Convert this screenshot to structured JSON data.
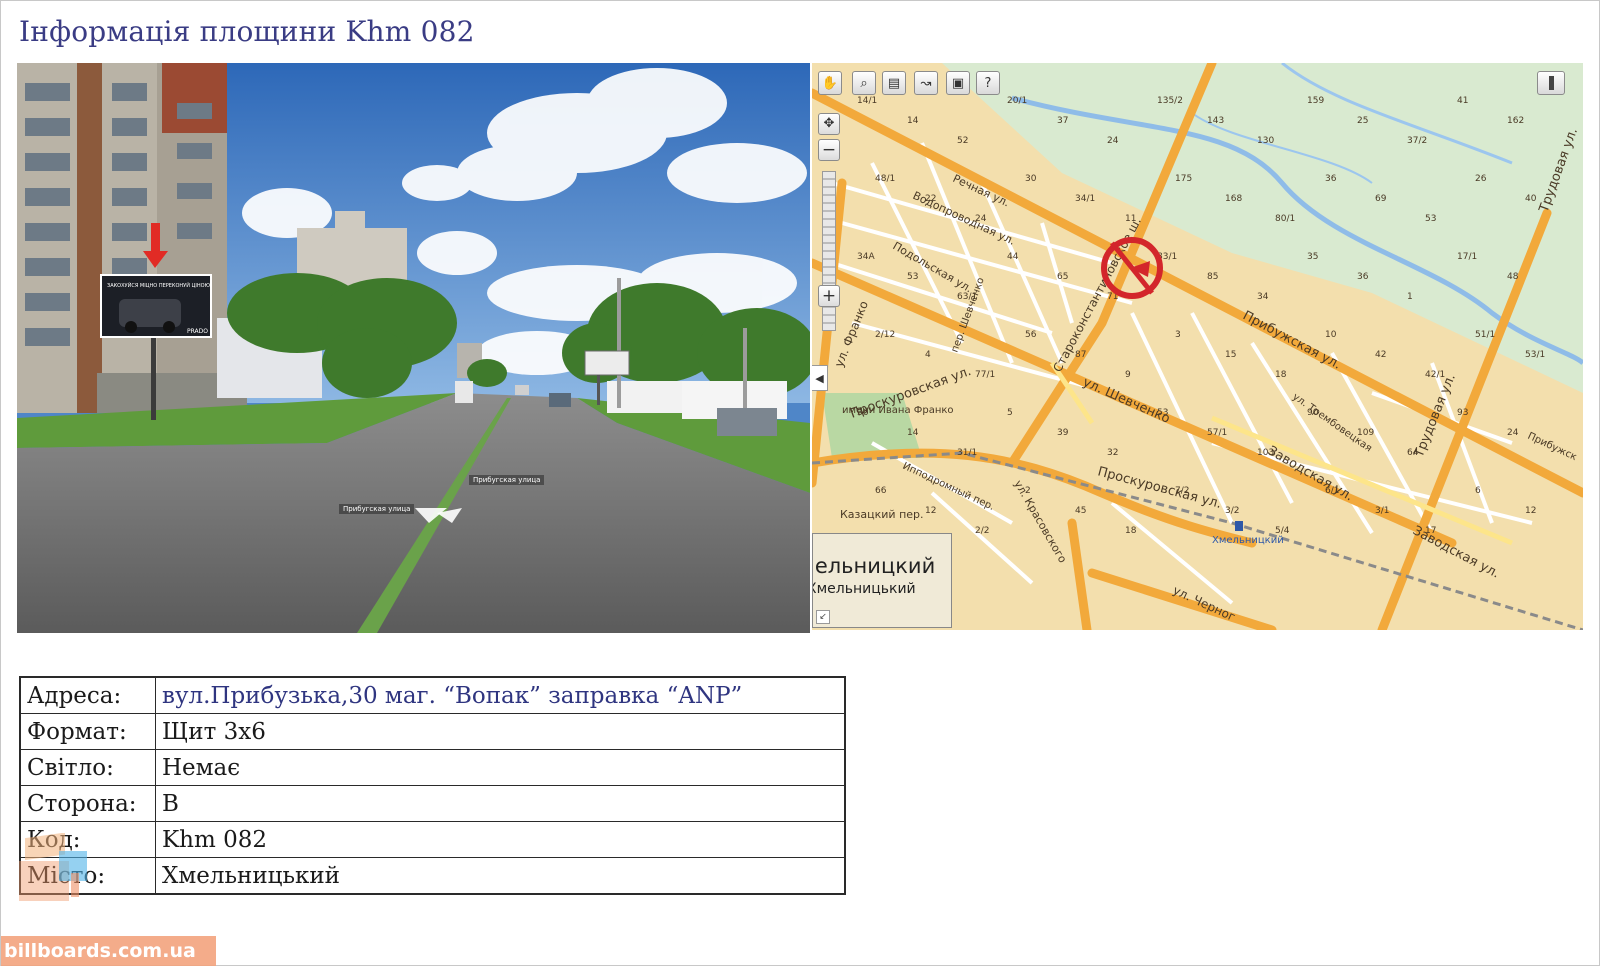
{
  "page": {
    "title": "Інформація площини Khm 082"
  },
  "photo": {
    "billboard_text": "ЗАКОХУЙСЯ МІЦНО ПЕРЕКОНУЙ ЦІНОЮ",
    "billboard_model": "PRADO",
    "road_label_1": "Прибугская улица",
    "road_label_2": "Прибугская улица"
  },
  "map": {
    "toolbar": [
      "hand-tool",
      "magnifier-tool",
      "ruler-tool",
      "route-tool",
      "print-tool",
      "help-tool"
    ],
    "toolbar_glyphs": [
      "✋",
      "🔍",
      "📏",
      "⛕",
      "🖶",
      "?"
    ],
    "zoom_in": "+",
    "zoom_out": "−",
    "collapse": "◀",
    "streets": {
      "pribuzhskaya": "Прибужская ул.",
      "shevchenko": "ул. Шевченко",
      "proskurovskaya_1": "Проскуровская ул.",
      "proskurovskaya_2": "Проскуровская ул.",
      "zavodskaya_1": "Заводская ул.",
      "zavodskaya_2": "Заводская ул.",
      "trudovaya_1": "Трудовая ул.",
      "trudovaya_2": "Трудовая ул.",
      "starokonst": "Староконстантиновское ш.",
      "franko": "ул. Франко",
      "rechnaya": "Речная ул.",
      "vodoprovodnaya": "Водопроводная ул.",
      "podolskaya": "Подольская ул.",
      "shevchenko_per": "пер. Шевченко",
      "ippodromny": "Ипподромный пер.",
      "kazatsky": "Казацкий пер.",
      "krasovskogo": "ул. Красовского",
      "trembovetskaya": "ул. Трембовецкая",
      "chernovola": "ул. Черног",
      "pribuzhskaya_edge": "Прибужск",
      "park": "имени Ивана Франко",
      "station": "Хмельницкий"
    },
    "house_numbers": [
      "14/1",
      "14",
      "52",
      "20/1",
      "37",
      "24",
      "135/2",
      "143",
      "130",
      "159",
      "25",
      "37/2",
      "41",
      "162",
      "48/1",
      "22",
      "24",
      "30",
      "34/1",
      "11",
      "175",
      "168",
      "80/1",
      "36",
      "69",
      "53",
      "26",
      "40",
      "34А",
      "53",
      "63/1",
      "44",
      "65",
      "71",
      "83/1",
      "85",
      "34",
      "35",
      "36",
      "1",
      "17/1",
      "48",
      "2/12",
      "4",
      "77/1",
      "56",
      "87",
      "9",
      "3",
      "15",
      "18",
      "10",
      "42",
      "42/1",
      "51/1",
      "53/1",
      "36",
      "14",
      "31/1",
      "5",
      "39",
      "32",
      "53",
      "57/1",
      "103",
      "90",
      "109",
      "64",
      "93",
      "24",
      "66",
      "12",
      "2/2",
      "2",
      "45",
      "18",
      "7/2",
      "3/2",
      "5/4",
      "6/1",
      "3/1",
      "17",
      "6",
      "12",
      "22",
      "40/1"
    ],
    "minimap_city": "мельницкий",
    "minimap_city_uk": "Хмельницький"
  },
  "info": {
    "rows": [
      {
        "label": "Адреса:",
        "value": "вул.Прибузька,30  маг. “Вопак” заправка “ANP”"
      },
      {
        "label": "Формат:",
        "value": "Щит 3x6"
      },
      {
        "label": "Світло:",
        "value": "Немає"
      },
      {
        "label": "Сторона:",
        "value": "В"
      },
      {
        "label": "Код:",
        "value": "Khm 082"
      },
      {
        "label": "Місто:",
        "value": "Хмельницький"
      }
    ]
  },
  "watermark": {
    "text": "billboards.com.ua"
  },
  "colors": {
    "title": "#3a3c84",
    "map_background": "#f3dfad",
    "major_road": "#f2a93b",
    "marker": "#d3262b"
  }
}
